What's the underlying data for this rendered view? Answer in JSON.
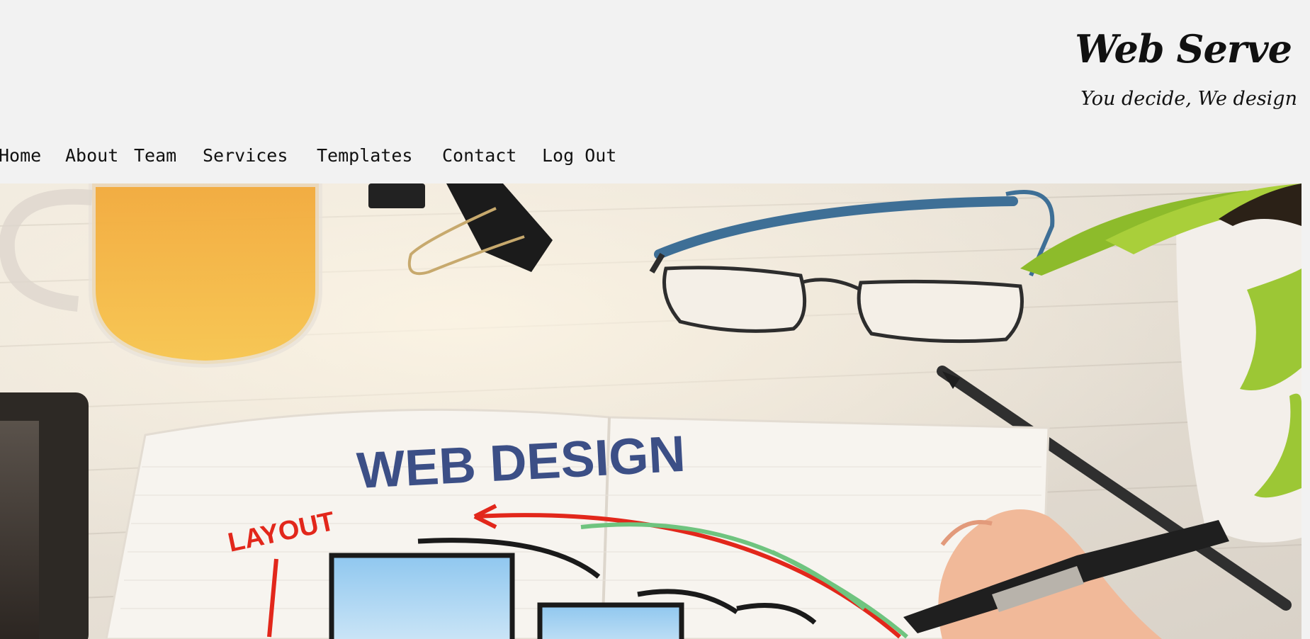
{
  "header": {
    "site_title": "Web Serve",
    "tagline": "You decide, We design"
  },
  "nav": {
    "items": [
      {
        "label": "Home"
      },
      {
        "label": "About"
      },
      {
        "label": "Team"
      },
      {
        "label": "Services"
      },
      {
        "label": "Templates"
      },
      {
        "label": "Contact"
      },
      {
        "label": "Log Out"
      }
    ]
  },
  "hero": {
    "notebook_heading": "WEB DESIGN",
    "notebook_label": "LAYOUT"
  },
  "colors": {
    "background": "#f2f2f2",
    "text": "#111111",
    "heading_blue": "#3c4f86",
    "sketch_red": "#e2271b",
    "sketch_green": "#6fc47f"
  }
}
